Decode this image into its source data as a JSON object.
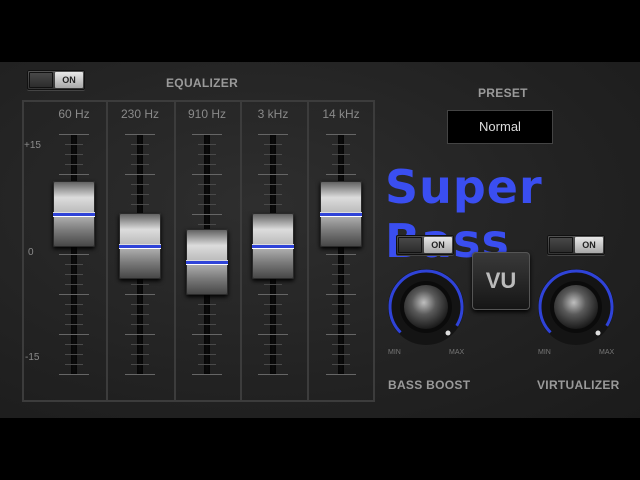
{
  "equalizer": {
    "toggle_label": "ON",
    "title": "EQUALIZER",
    "db_labels": {
      "top": "+15",
      "mid": "0",
      "bottom": "-15"
    },
    "bands": [
      {
        "freq": "60 Hz",
        "gain_db": 5
      },
      {
        "freq": "230 Hz",
        "gain_db": 1
      },
      {
        "freq": "910 Hz",
        "gain_db": -1
      },
      {
        "freq": "3 kHz",
        "gain_db": 1
      },
      {
        "freq": "14 kHz",
        "gain_db": 5
      }
    ]
  },
  "preset": {
    "label": "PRESET",
    "value": "Normal"
  },
  "app_title": "Super Bass",
  "vu_button": "VU",
  "bass_boost": {
    "toggle_label": "ON",
    "label": "BASS BOOST",
    "min": "MIN",
    "max": "MAX",
    "level": 0.95
  },
  "virtualizer": {
    "toggle_label": "ON",
    "label": "VIRTUALIZER",
    "min": "MIN",
    "max": "MAX",
    "level": 0.95
  },
  "colors": {
    "accent": "#2f43d8",
    "title": "#3a4ef0",
    "background": "#222222"
  }
}
